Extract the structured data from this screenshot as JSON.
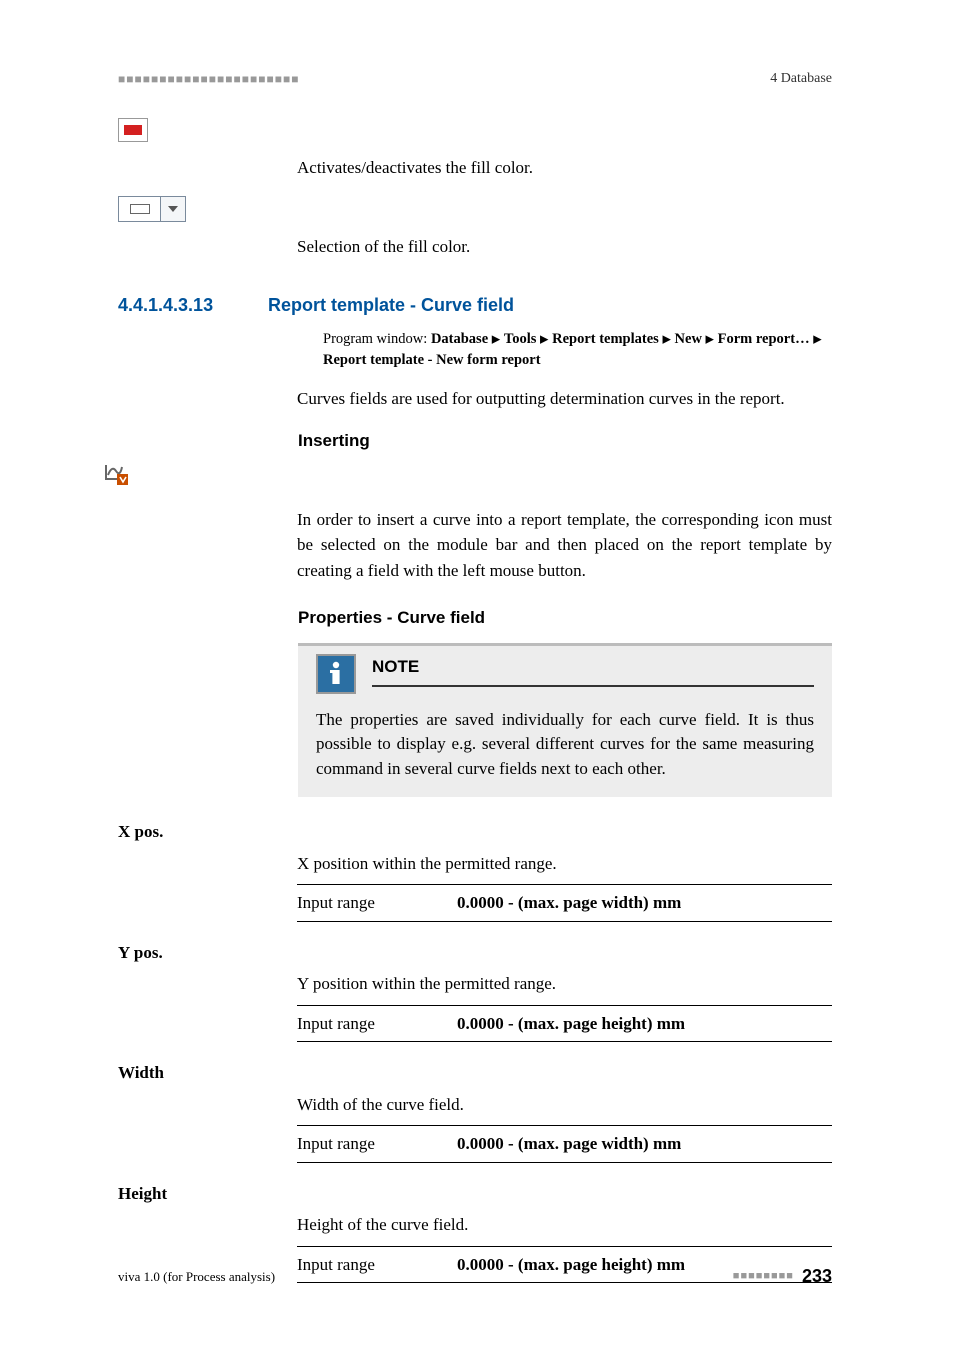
{
  "header": {
    "section": "4 Database"
  },
  "fill": {
    "activate_text": "Activates/deactivates the fill color.",
    "select_text": "Selection of the fill color."
  },
  "subsection": {
    "number": "4.4.1.4.3.13",
    "title": "Report template - Curve field"
  },
  "breadcrumb": {
    "prefix": "Program window: ",
    "p0": "Database",
    "p1": "Tools",
    "p2": "Report templates",
    "p3": "New",
    "p4": "Form report…",
    "p5": "Report template - New form report"
  },
  "curves_intro": "Curves fields are used for outputting determination curves in the report.",
  "inserting": {
    "title": "Inserting",
    "body": "In order to insert a curve into a report template, the corresponding icon must be selected on the module bar and then placed on the report template by creating a field with the left mouse button."
  },
  "properties": {
    "title": "Properties - Curve field"
  },
  "note": {
    "title": "NOTE",
    "body": "The properties are saved individually for each curve field. It is thus possible to display e.g. several different curves for the same measuring command in several curve fields next to each other."
  },
  "props": {
    "xpos": {
      "label": "X pos.",
      "desc": "X position within the permitted range.",
      "range_label": "Input range",
      "range_value": "0.0000 - (max. page width) mm"
    },
    "ypos": {
      "label": "Y pos.",
      "desc": "Y position within the permitted range.",
      "range_label": "Input range",
      "range_value": "0.0000 - (max. page height) mm"
    },
    "width": {
      "label": "Width",
      "desc": "Width of the curve field.",
      "range_label": "Input range",
      "range_value": "0.0000 - (max. page width) mm"
    },
    "height": {
      "label": "Height",
      "desc": "Height of the curve field.",
      "range_label": "Input range",
      "range_value": "0.0000 - (max. page height) mm"
    }
  },
  "footer": {
    "product": "viva 1.0 (for Process analysis)",
    "page_num": "233"
  }
}
